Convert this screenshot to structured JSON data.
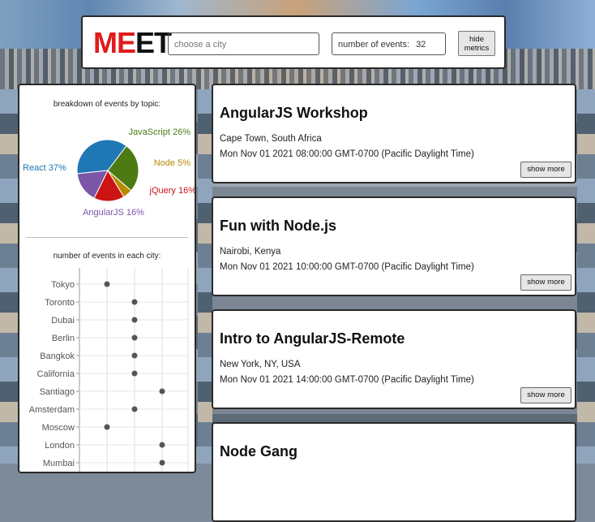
{
  "header": {
    "logo_red": "ME",
    "logo_black": "ET",
    "city_placeholder": "choose a city",
    "events_label": "number of events:",
    "events_value": "32",
    "hide_metrics": [
      "hide",
      "metrics"
    ]
  },
  "pie": {
    "title": "breakdown of events by topic:",
    "slices": [
      {
        "label": "React 37%",
        "value": 37,
        "color": "#1f77b4"
      },
      {
        "label": "JavaScript 26%",
        "value": 26,
        "color": "#4d7a13"
      },
      {
        "label": "Node 5%",
        "value": 5,
        "color": "#b88a00"
      },
      {
        "label": "jQuery 16%",
        "value": 16,
        "color": "#cc1414"
      },
      {
        "label": "AngularJS 16%",
        "value": 16,
        "color": "#7a55a8"
      }
    ]
  },
  "scatter": {
    "title": "number of events in each city:",
    "cities": [
      "Tokyo",
      "Toronto",
      "Dubai",
      "Berlin",
      "Bangkok",
      "California",
      "Santiago",
      "Amsterdam",
      "Moscow",
      "London",
      "Mumbai"
    ],
    "values": [
      1,
      2,
      2,
      2,
      2,
      2,
      3,
      2,
      1,
      3,
      3
    ]
  },
  "events": [
    {
      "title": "AngularJS Workshop",
      "location": "Cape Town, South Africa",
      "date": "Mon Nov 01 2021 08:00:00 GMT-0700 (Pacific Daylight Time)",
      "button": "show more"
    },
    {
      "title": "Fun with Node.js",
      "location": "Nairobi, Kenya",
      "date": "Mon Nov 01 2021 10:00:00 GMT-0700 (Pacific Daylight Time)",
      "button": "show more"
    },
    {
      "title": "Intro to AngularJS-Remote",
      "location": "New York, NY, USA",
      "date": "Mon Nov 01 2021 14:00:00 GMT-0700 (Pacific Daylight Time)",
      "button": "show more"
    },
    {
      "title": "Node Gang",
      "location": "",
      "date": "",
      "button": ""
    }
  ]
}
